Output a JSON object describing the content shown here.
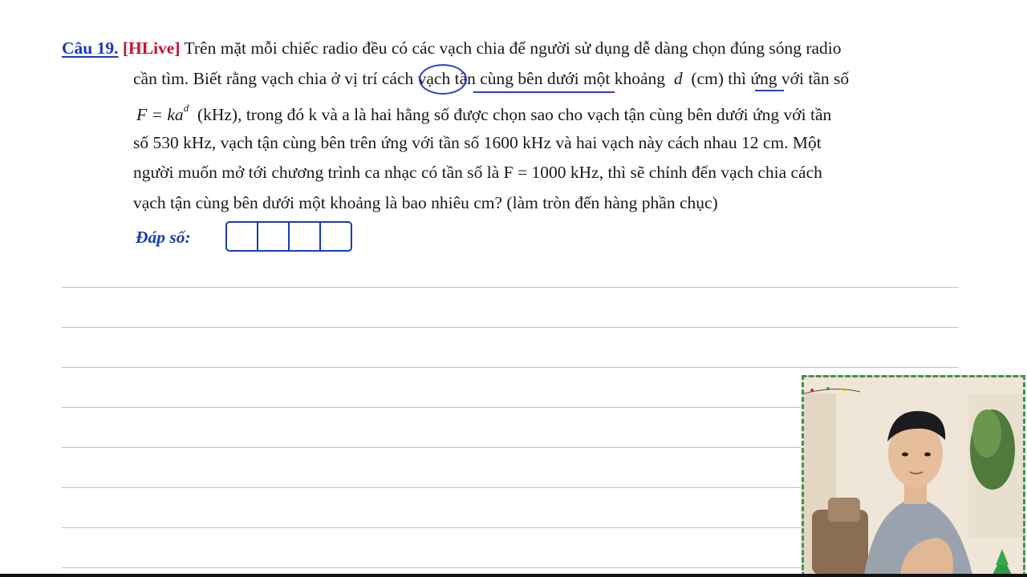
{
  "question": {
    "number": "Câu 19.",
    "tag": "[HLive]",
    "line1": "Trên mặt mỗi chiếc radio đều có các vạch chia để người sử dụng dễ dàng chọn đúng sóng radio",
    "line2_a": "cần tìm. Biết rằng vạch chia ở vị trí cách vạch tận cùng bên dưới một khoảng",
    "var_d": "d",
    "line2_b": "(cm) thì ứng với tần số",
    "formula_lhs": "F = ka",
    "formula_exp": "d",
    "line3": "(kHz), trong đó k và a là hai hằng số được chọn sao cho vạch tận cùng bên dưới ứng với tần",
    "line4": "số 530 kHz, vạch tận cùng bên trên ứng với tần số 1600 kHz và hai vạch này cách nhau 12 cm. Một",
    "line5": "người muốn mở tới chương trình ca nhạc có tần số là F = 1000 kHz, thì sẽ chỉnh đến vạch chia cách",
    "line6": "vạch tận cùng bên dưới một khoảng là bao nhiêu cm? (làm tròn đến hàng phần chục)"
  },
  "answer": {
    "label": "Đáp số:",
    "cells": 4
  },
  "colors": {
    "question_blue": "#1a3bb8",
    "tag_red": "#c8102e",
    "rule_cyan": "#8fd3e8",
    "annotation_blue": "#2c3fcf"
  }
}
